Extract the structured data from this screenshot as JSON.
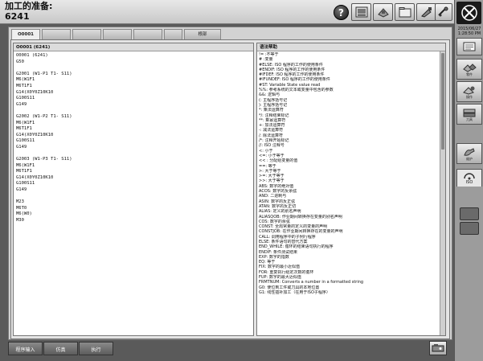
{
  "header": {
    "title": "加工的准备:",
    "subtitle": "6241",
    "help_label": "?",
    "icons": [
      "image-view-icon",
      "machine-icon",
      "folder-icon",
      "tool-icon",
      "measure-icon"
    ]
  },
  "sidebar": {
    "date": "2015/06/27",
    "time": "1:28:50 PM",
    "buttons": [
      {
        "icon": "program-list-icon",
        "label": ""
      },
      {
        "icon": "parts-icon",
        "label": "零件"
      },
      {
        "icon": "operations-icon",
        "label": "操作"
      },
      {
        "icon": "tool-data-icon",
        "label": "刀具"
      },
      {
        "icon": "hand-tool-icon",
        "label": "维护"
      }
    ],
    "iso_tab_label": "ISO"
  },
  "tabs": [
    {
      "label": "O0001"
    },
    {
      "label": ""
    },
    {
      "label": ""
    },
    {
      "label": ""
    },
    {
      "label": ""
    },
    {
      "label": ""
    },
    {
      "label": "根部"
    }
  ],
  "left_pane": {
    "header": "O0001 (6241)",
    "program_lines": [
      "O0001 (6241)",
      "G50",
      "",
      "G2001 (W1-P1 T1- S11)",
      "M6(W1F1",
      "M6T1F1",
      "G14(X0Y0Z10K10",
      "G100S11",
      "G149",
      "",
      "G2002 (W1-P2 T1- S11)",
      "M6(W1F1",
      "M6T1F1",
      "G14(X0Y0Z10K10",
      "G100S11",
      "G149",
      "",
      "G2003 (W1-P3 T1- S11)",
      "M6(W1F1",
      "M6T1F1",
      "G14(X0Y0Z10K10",
      "G100S11",
      "G149",
      "",
      "M23",
      "M6T0",
      "M6(W0)",
      "M30"
    ]
  },
  "right_pane": {
    "header": "语法帮助",
    "items": [
      "!= :不等于",
      "# :变量",
      "#ELSE: ISO 程序的工作的使用条件",
      "#ENDIF: ISO 程序的工作的使用条件",
      "#IFDEF: ISO 程序的工作的使用条件",
      "#IFUNDEF: ISO 程序的工作的使用条件",
      "#ST: Variable State value read",
      "%%: 参考系统的文本或变量中包含的参数",
      "&&: 逻辑与",
      "(: 主程序括号记",
      "): 主程序括号记",
      "*: 乘法运算符",
      "*/: 注释结束标记",
      "**: 乘幂运算符",
      "+: 加法运算符",
      "-: 减法运算符",
      "/: 除法运算符",
      "/*: 注释开始标记",
      "//: ISO 注释号",
      "<: 小于",
      "<=: 小于等于",
      "<< : 分配给变量的值",
      "==: 等于",
      ">: 大于等于",
      ">=: 大于等于",
      ">>: 大于等于",
      "ABS: 数字的绝对值",
      "ACOS: 数字的反余弦",
      "AND: 二进制与",
      "ASIN: 数字的反正弦",
      "ATAN: 数字的反正切",
      "ALIAS: 定义的别名声明",
      "ALIASQOB: 作业期间转换存在变量的别名声明",
      "COS: 数字的余弦",
      "CONST: 全局常量的定义的变量的声明",
      "CONSTJOB: 在作业期间转换存在的变量的声明",
      "CALL: 调用程序中的子例行程序",
      "ELSE: 条件语句的替代方案",
      "END_WHILE: 循环的结束语句执行的程序",
      "ENDIF: 条件测试结果",
      "EXP: 数字的指数",
      "EQ: 等于",
      "FIX: 数字的最小近似值",
      "FOR: 重复执行给定次数的循环",
      "FUP: 数字的最大近似值",
      "FRMTNUM: Converts a number in a formatted string",
      "G0: 使位到工件或刀具的本地位置",
      "G1: 线性插补加工（在用于ISO子程序）"
    ]
  },
  "bottom_buttons": [
    {
      "label": "程序输入"
    },
    {
      "label": "仿真"
    },
    {
      "label": "执行"
    }
  ]
}
